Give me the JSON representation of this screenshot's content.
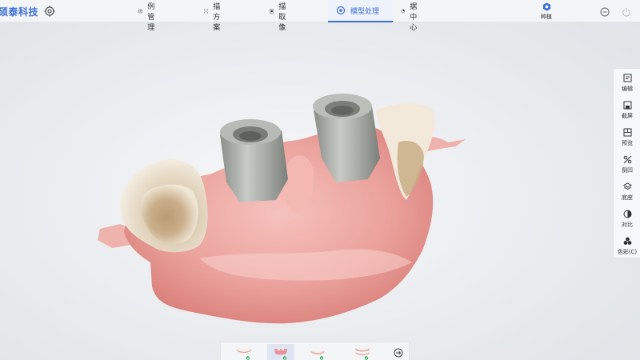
{
  "app": {
    "brand": "硕泰科技"
  },
  "tabs": [
    {
      "id": "case",
      "label": "案例管理",
      "icon": "folder-icon"
    },
    {
      "id": "scan_plan",
      "label": "扫描方案",
      "icon": "scan-frame-icon"
    },
    {
      "id": "scan_capture",
      "label": "扫描取像",
      "icon": "camera-frame-icon"
    },
    {
      "id": "model",
      "label": "模型处理",
      "icon": "model-gear-icon",
      "active": true
    },
    {
      "id": "data",
      "label": "数据中心",
      "icon": "pie-chart-icon"
    }
  ],
  "implant": {
    "label": "种植",
    "icon": "implant-icon"
  },
  "right_tools": [
    {
      "id": "edit",
      "label": "编辑",
      "icon": "edit-icon"
    },
    {
      "id": "screenshot",
      "label": "截屏",
      "icon": "save-icon"
    },
    {
      "id": "preview",
      "label": "预览",
      "icon": "preview-icon"
    },
    {
      "id": "undercut",
      "label": "倒凹",
      "icon": "undercut-icon"
    },
    {
      "id": "base",
      "label": "底座",
      "icon": "layers-icon"
    },
    {
      "id": "contrast",
      "label": "对比",
      "icon": "contrast-icon"
    },
    {
      "id": "color",
      "label": "色彩(C)",
      "icon": "color-dots-icon"
    }
  ],
  "thumbnails": [
    {
      "id": "upper",
      "icon": "upper-jaw-icon",
      "checked": true,
      "selected": false
    },
    {
      "id": "gum",
      "icon": "gum-model-icon",
      "checked": true,
      "selected": true
    },
    {
      "id": "lower",
      "icon": "lower-jaw-icon",
      "checked": true,
      "selected": false
    },
    {
      "id": "bite",
      "icon": "bite-icon",
      "checked": true,
      "selected": false
    }
  ],
  "colors": {
    "accent": "#3d6fd6",
    "check": "#2fae5a",
    "gum": "#e89a96",
    "abutment": "#9a9c98",
    "tooth": "#d8c5a4"
  }
}
